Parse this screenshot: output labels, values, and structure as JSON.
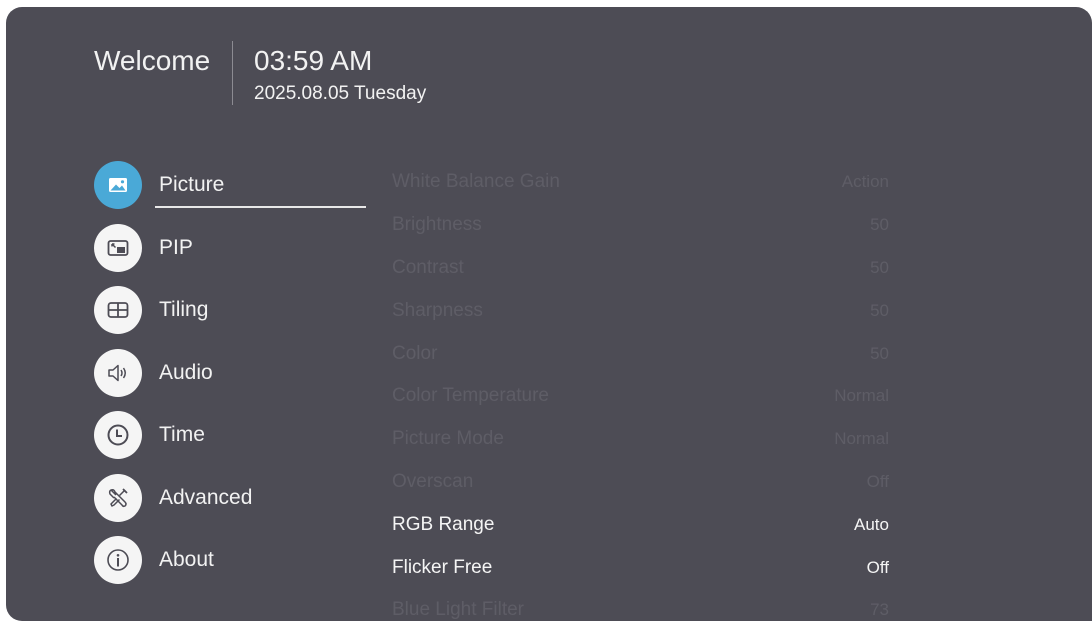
{
  "header": {
    "welcome": "Welcome",
    "time": "03:59 AM",
    "date": "2025.08.05 Tuesday"
  },
  "menu": {
    "items": [
      {
        "label": "Picture",
        "icon": "picture-icon",
        "active": true
      },
      {
        "label": "PIP",
        "icon": "pip-icon",
        "active": false
      },
      {
        "label": "Tiling",
        "icon": "tiling-icon",
        "active": false
      },
      {
        "label": "Audio",
        "icon": "audio-icon",
        "active": false
      },
      {
        "label": "Time",
        "icon": "clock-icon",
        "active": false
      },
      {
        "label": "Advanced",
        "icon": "tools-icon",
        "active": false
      },
      {
        "label": "About",
        "icon": "info-icon",
        "active": false
      }
    ]
  },
  "settings": {
    "rows": [
      {
        "name": "White Balance Gain",
        "value": "Action",
        "state": "dim"
      },
      {
        "name": "Brightness",
        "value": "50",
        "state": "dim"
      },
      {
        "name": "Contrast",
        "value": "50",
        "state": "dim"
      },
      {
        "name": "Sharpness",
        "value": "50",
        "state": "dim"
      },
      {
        "name": "Color",
        "value": "50",
        "state": "dim"
      },
      {
        "name": "Color Temperature",
        "value": "Normal",
        "state": "dim"
      },
      {
        "name": "Picture Mode",
        "value": "Normal",
        "state": "dim"
      },
      {
        "name": "Overscan",
        "value": "Off",
        "state": "dim"
      },
      {
        "name": "RGB Range",
        "value": "Auto",
        "state": "bright"
      },
      {
        "name": "Flicker Free",
        "value": "Off",
        "state": "bright"
      },
      {
        "name": "Blue Light Filter",
        "value": "73",
        "state": "dim"
      }
    ]
  },
  "colors": {
    "panel": "#4d4c55",
    "accent": "#4aa9d7",
    "text": "#f2f2f2",
    "dim_text": "#5e5d66"
  }
}
